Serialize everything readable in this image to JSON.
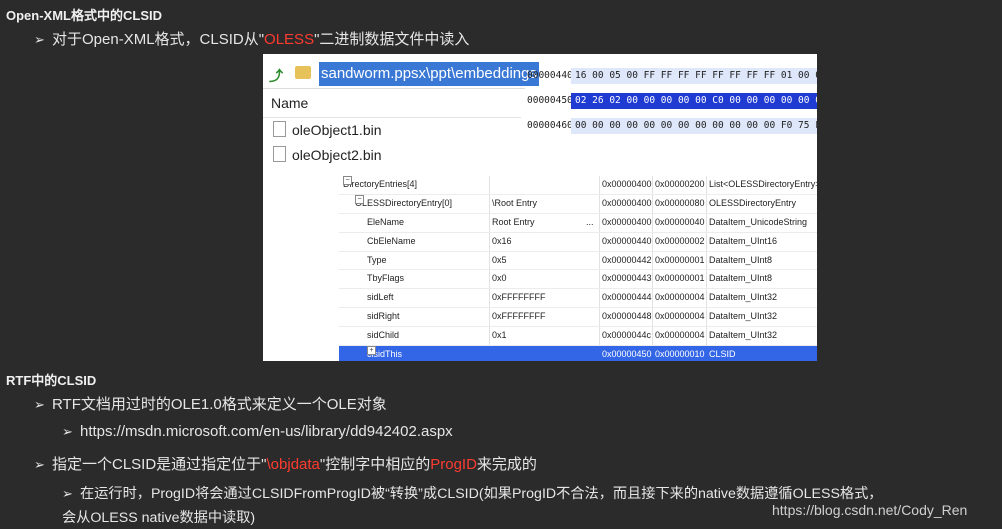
{
  "headings": {
    "h1": "Open-XML格式中的CLSID",
    "h2": "RTF中的CLSID"
  },
  "bullets": {
    "b1": {
      "arrow": "➢",
      "pre": "对于Open-XML格式，CLSID从\"",
      "red": "OLESS",
      "post": "\"二进制数据文件中读入"
    },
    "b2": {
      "arrow": "➢",
      "text": "RTF文档用过时的OLE1.0格式来定义一个OLE对象"
    },
    "b3": {
      "arrow": "➢",
      "text": "https://msdn.microsoft.com/en-us/library/dd942402.aspx"
    },
    "b4": {
      "arrow": "➢",
      "pre": "指定一个CLSID是通过指定位于\"",
      "red1": "\\objdata",
      "mid": "\"控制字中相应的",
      "red2": "ProgID",
      "post": "来完成的"
    },
    "b5": {
      "arrow": "➢",
      "line1": "在运行时，ProgID将会通过CLSIDFromProgID被“转换”成CLSID(如果ProgID不合法，而且接下来的native数据遵循OLESS格式，",
      "line2": "会从OLESS native数据中读取)"
    }
  },
  "screenshot": {
    "explorer": {
      "path": "sandworm.ppsx\\ppt\\embeddings",
      "name_header": "Name",
      "files": [
        "oleObject1.bin",
        "oleObject2.bin"
      ]
    },
    "hex": [
      {
        "offset": "00000440",
        "bytes": "16 00 05 00 FF FF FF FF FF FF FF FF 01 00 00 00",
        "selected": false
      },
      {
        "offset": "00000450",
        "bytes": "02 26 02 00 00 00 00 00 C0 00 00 00 00 00 00 46",
        "selected": true
      },
      {
        "offset": "00000460",
        "bytes": "00 00 00 00 00 00 00 00 00 00 00 00 F0 75 FD 41",
        "selected": false
      }
    ],
    "tree": [
      {
        "name": "DirectoryEntries[4]",
        "value": "",
        "offset": "0x00000400",
        "size": "0x00000200",
        "type": "List<OLESSDirectoryEntry>",
        "indent": 0,
        "expander": "−",
        "selected": false
      },
      {
        "name": "OLESSDirectoryEntry[0]",
        "value": "\\Root Entry",
        "offset": "0x00000400",
        "size": "0x00000080",
        "type": "OLESSDirectoryEntry",
        "indent": 1,
        "expander": "−",
        "selected": false
      },
      {
        "name": "EleName",
        "value": "Root Entry",
        "dots": "...",
        "offset": "0x00000400",
        "size": "0x00000040",
        "type": "DataItem_UnicodeString",
        "indent": 2,
        "expander": "",
        "selected": false
      },
      {
        "name": "CbEleName",
        "value": "0x16",
        "offset": "0x00000440",
        "size": "0x00000002",
        "type": "DataItem_UInt16",
        "indent": 2,
        "expander": "",
        "selected": false
      },
      {
        "name": "Type",
        "value": "0x5",
        "offset": "0x00000442",
        "size": "0x00000001",
        "type": "DataItem_UInt8",
        "indent": 2,
        "expander": "",
        "selected": false
      },
      {
        "name": "TbyFlags",
        "value": "0x0",
        "offset": "0x00000443",
        "size": "0x00000001",
        "type": "DataItem_UInt8",
        "indent": 2,
        "expander": "",
        "selected": false
      },
      {
        "name": "sidLeft",
        "value": "0xFFFFFFFF",
        "offset": "0x00000444",
        "size": "0x00000004",
        "type": "DataItem_UInt32",
        "indent": 2,
        "expander": "",
        "selected": false
      },
      {
        "name": "sidRight",
        "value": "0xFFFFFFFF",
        "offset": "0x00000448",
        "size": "0x00000004",
        "type": "DataItem_UInt32",
        "indent": 2,
        "expander": "",
        "selected": false
      },
      {
        "name": "sidChild",
        "value": "0x1",
        "offset": "0x0000044c",
        "size": "0x00000004",
        "type": "DataItem_UInt32",
        "indent": 2,
        "expander": "",
        "selected": false
      },
      {
        "name": "clsidThis",
        "value": "",
        "offset": "0x00000450",
        "size": "0x00000010",
        "type": "CLSID",
        "indent": 2,
        "expander": "+",
        "selected": true
      }
    ]
  },
  "footer": {
    "url": "https://blog.csdn.net/Cody_Ren"
  },
  "colors": {
    "background": "#2b2b2b",
    "accent_red": "#ff3b30",
    "selection_blue": "#3366e6"
  }
}
